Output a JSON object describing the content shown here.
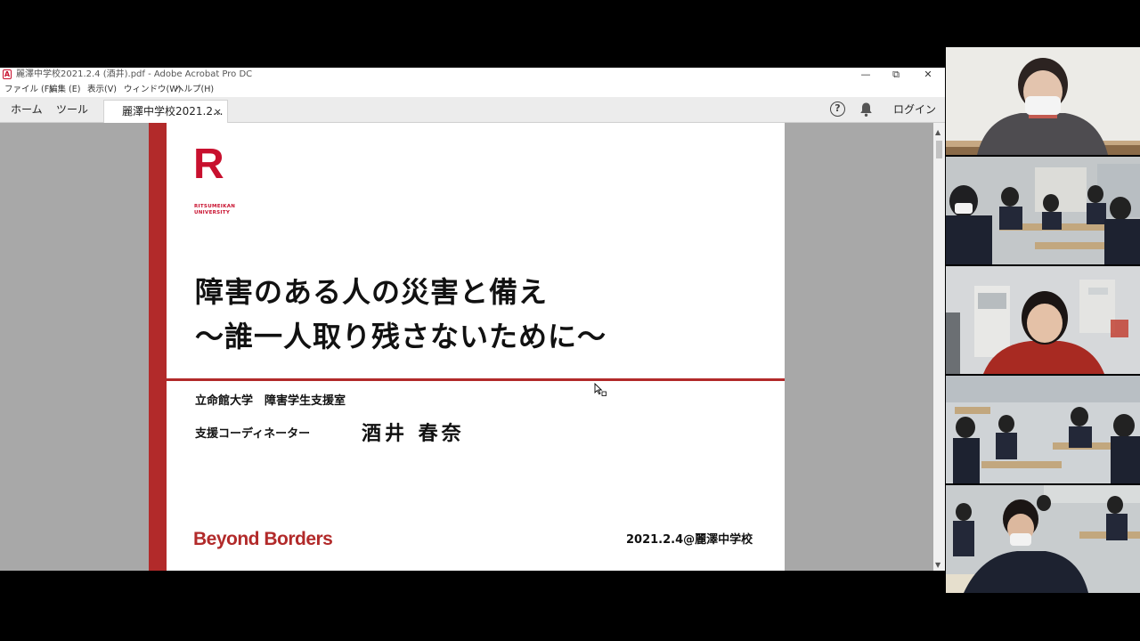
{
  "window": {
    "title": "麗澤中学校2021.2.4 (酒井).pdf - Adobe Acrobat Pro DC",
    "controls": {
      "minimize": "—",
      "restore": "⧉",
      "close": "✕"
    }
  },
  "menu": [
    "ファイル (F)",
    "編集 (E)",
    "表示(V)",
    "ウィンドウ(W)",
    "ヘルプ(H)"
  ],
  "tabs": {
    "home": "ホーム",
    "tools": "ツール",
    "document": "麗澤中学校2021.2...",
    "close": "×",
    "help": "?",
    "login": "ログイン"
  },
  "slide": {
    "logo_letter": "R",
    "logo_sub": "RITSUMEIKAN UNIVERSITY",
    "title_line1": "障害のある人の災害と備え",
    "title_line2": "〜誰一人取り残さないために〜",
    "organization": "立命館大学　障害学生支援室",
    "role": "支援コーディネーター",
    "presenter": "酒井 春奈",
    "tagline": "Beyond Borders",
    "date_place": "2021.2.4@麗澤中学校"
  },
  "colors": {
    "accent": "#b22a2a",
    "logo": "#c8102e",
    "viewport_bg": "#a8a8a8"
  },
  "icons": [
    "pdf-app-icon",
    "help-icon",
    "bell-icon",
    "cursor-icon"
  ],
  "video_participants": [
    {
      "name": "presenter-teacher-video"
    },
    {
      "name": "classroom-video-1"
    },
    {
      "name": "student-presenter-video"
    },
    {
      "name": "classroom-video-2"
    },
    {
      "name": "classroom-video-3"
    }
  ]
}
